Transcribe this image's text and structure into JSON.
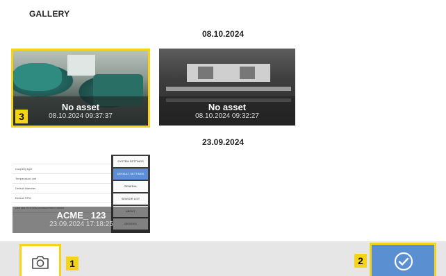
{
  "gallery": {
    "title": "GALLERY",
    "groups": [
      {
        "date": "08.10.2024",
        "items": [
          {
            "caption": "No asset",
            "timestamp": "08.10.2024 09:37:37",
            "marker": "3"
          },
          {
            "caption": "No asset",
            "timestamp": "08.10.2024 09:32:27"
          }
        ]
      },
      {
        "date": "23.09.2024",
        "items": [
          {
            "caption": "ACME_ 123",
            "timestamp": "23.09.2024 17:18:25",
            "screen_rows": [
              "",
              "Coupling type",
              "Temperature unit",
              "Default diameter",
              "Default RPM",
              "Use last SYSTEM measurement values",
              "",
              "",
              ""
            ],
            "screen_menu": [
              "SYSTEM SETTINGS",
              "DEFAULT SETTINGS",
              "GENERAL",
              "SENSOR LIST",
              "ABOUT",
              "DEVICES"
            ]
          }
        ]
      }
    ]
  },
  "footer": {
    "camera_icon": "camera-icon",
    "camera_marker": "1",
    "confirm_icon": "check-circle-icon",
    "confirm_marker": "2"
  },
  "colors": {
    "highlight": "#f5d418",
    "accent": "#5a8fd1",
    "footer_bg": "#e6e6e6"
  }
}
